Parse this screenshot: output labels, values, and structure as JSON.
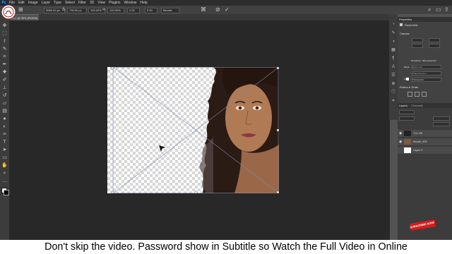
{
  "app": {
    "logo_text": "Ps",
    "menu": [
      "File",
      "Edit",
      "Image",
      "Layer",
      "Type",
      "Select",
      "Filter",
      "3D",
      "View",
      "Plugins",
      "Window",
      "Help"
    ]
  },
  "options_bar": {
    "x_value": "5065.00 px",
    "y_value": "735.00 px",
    "w_value": "100.00%",
    "h_value": "100.00%",
    "angle_value": "0.00",
    "h_skew": "0.00",
    "interp": "Bicubic"
  },
  "document": {
    "tab_label": "Ui-1 @ 35% (RGB/8)"
  },
  "panels": {
    "properties": {
      "title": "Properties",
      "subtitle": "Document",
      "canvas_section": "Canvas",
      "resolution_text": "Resolution: 300 pixels/inch",
      "mode_label": "Mode",
      "mode_value": "RGB Color",
      "bits_value": "8 Bits/Channel",
      "fill_label": "Fill",
      "fill_value": "Transparent",
      "rulers_section": "Rulers & Grids"
    },
    "layers": {
      "tab_layers": "Layers",
      "tab_channels": "Channels",
      "rows": [
        {
          "name": "TCL 88"
        },
        {
          "name": "Model_002"
        },
        {
          "name": "Layer 0"
        }
      ]
    }
  },
  "overlay": {
    "subtitle": "Don't skip the video. Password show in Subtitle so Watch the Full Video in Online",
    "subscribe_label": "SUBSCRIBE NOW!"
  },
  "icons": {
    "tools": [
      "move-icon",
      "marquee-icon",
      "lasso-icon",
      "quick-select-icon",
      "crop-icon",
      "eyedropper-icon",
      "healing-icon",
      "brush-icon",
      "stamp-icon",
      "history-brush-icon",
      "eraser-icon",
      "gradient-icon",
      "blur-icon",
      "dodge-icon",
      "pen-icon",
      "type-icon",
      "path-select-icon",
      "shape-icon",
      "hand-icon",
      "zoom-icon",
      "more-icon",
      "color-swatch-icon"
    ],
    "colors": {
      "accent": "#31a8ff",
      "subscribe": "#d71a1a"
    }
  }
}
